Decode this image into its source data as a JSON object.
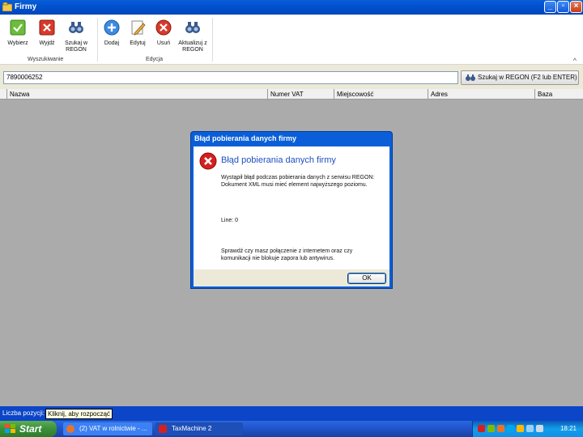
{
  "window": {
    "title": "Firmy"
  },
  "ribbon": {
    "buttons": [
      {
        "label": "Wybierz",
        "icon": "check-icon"
      },
      {
        "label": "Wyjdź",
        "icon": "x-icon"
      },
      {
        "label": "Szukaj w REGON",
        "icon": "binoculars-icon"
      },
      {
        "label": "Dodaj",
        "icon": "plus-icon"
      },
      {
        "label": "Edytuj",
        "icon": "pencil-icon"
      },
      {
        "label": "Usuń",
        "icon": "delete-icon"
      },
      {
        "label": "Aktualizuj z REGON",
        "icon": "binoculars-icon"
      }
    ],
    "groups": [
      {
        "label": "Wyszukiwanie"
      },
      {
        "label": "Edycja"
      }
    ]
  },
  "search": {
    "value": "7890006252",
    "button_label": "Szukaj w REGON (F2 lub ENTER)"
  },
  "grid": {
    "columns": [
      "Nazwa",
      "Numer VAT",
      "Miejscowość",
      "Adres",
      "Baza"
    ]
  },
  "dialog": {
    "title": "Błąd pobierania danych firmy",
    "heading": "Błąd pobierania danych firmy",
    "message": "Wystąpił błąd podczas pobierania danych z serwisu REGON: Dokument XML musi mieć element najwyższego poziomu.",
    "line": "Line: 0",
    "hint": "Sprawdź czy masz połączenie z internetem oraz czy komunikacji nie blokuje zapora lub antywirus.",
    "ok_label": "OK"
  },
  "status": {
    "label": "Liczba pozycji:",
    "tooltip": "Kliknij, aby rozpocząć"
  },
  "taskbar": {
    "start_label": "Start",
    "tasks": [
      {
        "label": "(2) VAT w rolnictwie - ..."
      },
      {
        "label": "TaxMachine 2"
      }
    ],
    "clock": "18:21"
  },
  "colors": {
    "title_bar": "#0a5fd8",
    "taskbar": "#245edb",
    "start": "#3c8f3a",
    "error": "#d42020",
    "dialog_heading": "#1f4fbf"
  }
}
